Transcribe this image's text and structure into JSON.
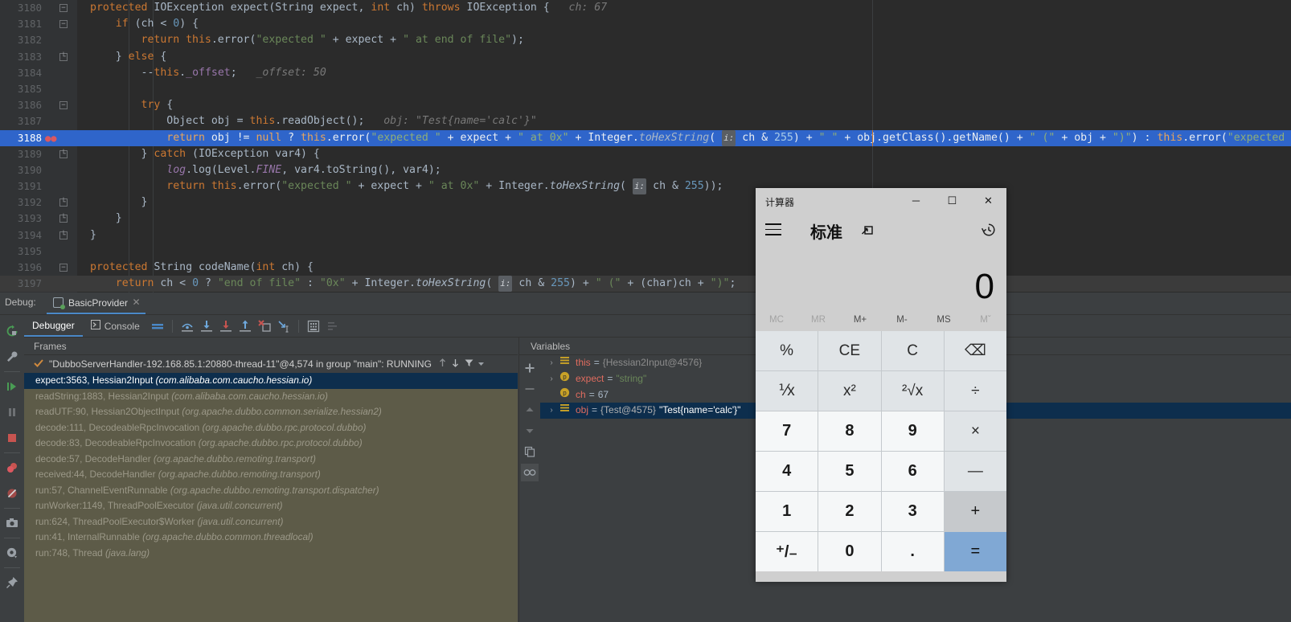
{
  "editor": {
    "lines": [
      {
        "num": "3180",
        "fold": "open",
        "bp": "",
        "hl": false,
        "tokens": [
          {
            "t": "protected ",
            "c": "kw"
          },
          {
            "t": "IOException ",
            "c": "plain"
          },
          {
            "t": "expect",
            "c": "plain"
          },
          {
            "t": "(",
            "c": "plain"
          },
          {
            "t": "String ",
            "c": "plain"
          },
          {
            "t": "expect",
            "c": "plain"
          },
          {
            "t": ", ",
            "c": "plain"
          },
          {
            "t": "int",
            "c": "kw"
          },
          {
            "t": " ch) ",
            "c": "plain"
          },
          {
            "t": "throws ",
            "c": "kw"
          },
          {
            "t": "IOException {",
            "c": "plain"
          },
          {
            "t": "   ch: 67",
            "c": "hint"
          }
        ]
      },
      {
        "num": "3181",
        "fold": "open",
        "bp": "",
        "hl": false,
        "tokens": [
          {
            "t": "    if",
            "c": "kw"
          },
          {
            "t": " (ch ",
            "c": "plain"
          },
          {
            "t": "<",
            "c": "plain"
          },
          {
            "t": " ",
            "c": "plain"
          },
          {
            "t": "0",
            "c": "num"
          },
          {
            "t": ") {",
            "c": "plain"
          }
        ]
      },
      {
        "num": "3182",
        "fold": "",
        "bp": "",
        "hl": false,
        "tokens": [
          {
            "t": "        return ",
            "c": "kw"
          },
          {
            "t": "this",
            "c": "kw"
          },
          {
            "t": ".error(",
            "c": "plain"
          },
          {
            "t": "\"expected \"",
            "c": "str"
          },
          {
            "t": " + expect + ",
            "c": "plain"
          },
          {
            "t": "\" at end of file\"",
            "c": "str"
          },
          {
            "t": ");",
            "c": "plain"
          }
        ]
      },
      {
        "num": "3183",
        "fold": "close",
        "bp": "",
        "hl": false,
        "tokens": [
          {
            "t": "    } ",
            "c": "plain"
          },
          {
            "t": "else",
            "c": "kw"
          },
          {
            "t": " {",
            "c": "plain"
          }
        ]
      },
      {
        "num": "3184",
        "fold": "",
        "bp": "",
        "hl": false,
        "tokens": [
          {
            "t": "        --",
            "c": "plain"
          },
          {
            "t": "this",
            "c": "kw"
          },
          {
            "t": ".",
            "c": "plain"
          },
          {
            "t": "_offset",
            "c": "fld"
          },
          {
            "t": ";",
            "c": "plain"
          },
          {
            "t": "   _offset: 50",
            "c": "hint"
          }
        ]
      },
      {
        "num": "3185",
        "fold": "",
        "bp": "",
        "hl": false,
        "tokens": []
      },
      {
        "num": "3186",
        "fold": "open",
        "bp": "",
        "hl": false,
        "tokens": [
          {
            "t": "        try",
            "c": "kw"
          },
          {
            "t": " {",
            "c": "plain"
          }
        ]
      },
      {
        "num": "3187",
        "fold": "",
        "bp": "",
        "hl": false,
        "tokens": [
          {
            "t": "            Object obj = ",
            "c": "plain"
          },
          {
            "t": "this",
            "c": "kw"
          },
          {
            "t": ".readObject();",
            "c": "plain"
          },
          {
            "t": "   obj: \"Test{name='calc'}\"",
            "c": "hint"
          }
        ]
      },
      {
        "num": "3188",
        "fold": "",
        "bp": "bp",
        "hl": true,
        "tokens": [
          {
            "t": "            return ",
            "c": "kw"
          },
          {
            "t": "obj != ",
            "c": "plain"
          },
          {
            "t": "null",
            "c": "kw"
          },
          {
            "t": " ? ",
            "c": "plain"
          },
          {
            "t": "this",
            "c": "kw"
          },
          {
            "t": ".error(",
            "c": "plain"
          },
          {
            "t": "\"expected \"",
            "c": "str"
          },
          {
            "t": " + expect + ",
            "c": "plain"
          },
          {
            "t": "\" at 0x\"",
            "c": "str"
          },
          {
            "t": " + Integer.",
            "c": "plain"
          },
          {
            "t": "toHexString",
            "c": "mth-it"
          },
          {
            "t": "( ",
            "c": "plain"
          },
          {
            "t": "i:",
            "c": "chip"
          },
          {
            "t": " ch & ",
            "c": "plain"
          },
          {
            "t": "255",
            "c": "num"
          },
          {
            "t": ") + ",
            "c": "plain"
          },
          {
            "t": "\" \"",
            "c": "str"
          },
          {
            "t": " + obj.getClass().getName() + ",
            "c": "plain"
          },
          {
            "t": "\" (\"",
            "c": "str"
          },
          {
            "t": " + obj + ",
            "c": "plain"
          },
          {
            "t": "\")\"",
            "c": "str"
          },
          {
            "t": ") : ",
            "c": "plain"
          },
          {
            "t": "this",
            "c": "kw"
          },
          {
            "t": ".error(",
            "c": "plain"
          },
          {
            "t": "\"expected",
            "c": "str"
          }
        ]
      },
      {
        "num": "3189",
        "fold": "close",
        "bp": "",
        "hl": false,
        "tokens": [
          {
            "t": "        } ",
            "c": "plain"
          },
          {
            "t": "catch",
            "c": "kw"
          },
          {
            "t": " (IOException var4) {",
            "c": "plain"
          }
        ]
      },
      {
        "num": "3190",
        "fold": "",
        "bp": "",
        "hl": false,
        "tokens": [
          {
            "t": "            ",
            "c": "plain"
          },
          {
            "t": "log",
            "c": "static-it"
          },
          {
            "t": ".log(Level.",
            "c": "plain"
          },
          {
            "t": "FINE",
            "c": "static-it"
          },
          {
            "t": ", var4.toString(), var4);",
            "c": "plain"
          }
        ]
      },
      {
        "num": "3191",
        "fold": "",
        "bp": "",
        "hl": false,
        "tokens": [
          {
            "t": "            return ",
            "c": "kw"
          },
          {
            "t": "this",
            "c": "kw"
          },
          {
            "t": ".error(",
            "c": "plain"
          },
          {
            "t": "\"expected \"",
            "c": "str"
          },
          {
            "t": " + expect + ",
            "c": "plain"
          },
          {
            "t": "\" at 0x\"",
            "c": "str"
          },
          {
            "t": " + Integer.",
            "c": "plain"
          },
          {
            "t": "toHexString",
            "c": "mth-it"
          },
          {
            "t": "( ",
            "c": "plain"
          },
          {
            "t": "i:",
            "c": "chip"
          },
          {
            "t": " ch & ",
            "c": "plain"
          },
          {
            "t": "255",
            "c": "num"
          },
          {
            "t": "));",
            "c": "plain"
          }
        ]
      },
      {
        "num": "3192",
        "fold": "close",
        "bp": "",
        "hl": false,
        "tokens": [
          {
            "t": "        }",
            "c": "plain"
          }
        ]
      },
      {
        "num": "3193",
        "fold": "close",
        "bp": "",
        "hl": false,
        "tokens": [
          {
            "t": "    }",
            "c": "plain"
          }
        ]
      },
      {
        "num": "3194",
        "fold": "close",
        "bp": "",
        "hl": false,
        "tokens": [
          {
            "t": "}",
            "c": "plain"
          }
        ]
      },
      {
        "num": "3195",
        "fold": "",
        "bp": "",
        "hl": false,
        "tokens": []
      },
      {
        "num": "3196",
        "fold": "open",
        "bp": "",
        "hl": false,
        "tokens": [
          {
            "t": "protected ",
            "c": "kw"
          },
          {
            "t": "String ",
            "c": "plain"
          },
          {
            "t": "codeName",
            "c": "plain"
          },
          {
            "t": "(",
            "c": "plain"
          },
          {
            "t": "int",
            "c": "kw"
          },
          {
            "t": " ch) {",
            "c": "plain"
          }
        ]
      },
      {
        "num": "3197",
        "fold": "",
        "bp": "",
        "hl": false,
        "soft": true,
        "tokens": [
          {
            "t": "    return ",
            "c": "kw"
          },
          {
            "t": "ch ",
            "c": "plain"
          },
          {
            "t": "< ",
            "c": "plain"
          },
          {
            "t": "0",
            "c": "num"
          },
          {
            "t": " ? ",
            "c": "plain"
          },
          {
            "t": "\"end of file\"",
            "c": "str"
          },
          {
            "t": " : ",
            "c": "plain"
          },
          {
            "t": "\"0x\"",
            "c": "str"
          },
          {
            "t": " + Integer.",
            "c": "plain"
          },
          {
            "t": "toHexString",
            "c": "mth-it"
          },
          {
            "t": "( ",
            "c": "plain"
          },
          {
            "t": "i:",
            "c": "chip"
          },
          {
            "t": " ch & ",
            "c": "plain"
          },
          {
            "t": "255",
            "c": "num"
          },
          {
            "t": ") + ",
            "c": "plain"
          },
          {
            "t": "\" (\"",
            "c": "str"
          },
          {
            "t": " + (char)ch + ",
            "c": "plain"
          },
          {
            "t": "\")\"",
            "c": "str"
          },
          {
            "t": ";",
            "c": "plain"
          }
        ]
      }
    ]
  },
  "debug": {
    "label": "Debug:",
    "session_tab": "BasicProvider",
    "tabs": [
      {
        "label": "Debugger",
        "active": true
      },
      {
        "label": "Console",
        "active": false
      }
    ],
    "toolbar_icons": [
      "mute-breakpoints-icon",
      "step-over-icon",
      "step-into-icon",
      "force-step-into-icon",
      "step-out-icon",
      "run-to-cursor-icon",
      "drop-frame-icon",
      "evaluate-expression-icon",
      "settings-list-icon"
    ],
    "rail_icons": [
      "rerun-icon",
      "wrench-icon",
      "resume-icon",
      "pause-icon",
      "stop-icon",
      "view-breakpoints-icon",
      "mute-breakpoints-icon",
      "camera-icon",
      "settings-gear-icon",
      "pin-icon"
    ],
    "frames": {
      "title": "Frames",
      "thread": "\"DubboServerHandler-192.168.85.1:20880-thread-11\"@4,574 in group \"main\": RUNNING",
      "tools": [
        "arrow-up-icon",
        "arrow-down-icon",
        "filter-icon",
        "chevron-down-icon"
      ],
      "items": [
        {
          "method": "expect:3563, Hessian2Input ",
          "pkg": "(com.alibaba.com.caucho.hessian.io)",
          "selected": true
        },
        {
          "method": "readString:1883, Hessian2Input ",
          "pkg": "(com.alibaba.com.caucho.hessian.io)",
          "selected": false
        },
        {
          "method": "readUTF:90, Hessian2ObjectInput ",
          "pkg": "(org.apache.dubbo.common.serialize.hessian2)",
          "selected": false
        },
        {
          "method": "decode:111, DecodeableRpcInvocation ",
          "pkg": "(org.apache.dubbo.rpc.protocol.dubbo)",
          "selected": false
        },
        {
          "method": "decode:83, DecodeableRpcInvocation ",
          "pkg": "(org.apache.dubbo.rpc.protocol.dubbo)",
          "selected": false
        },
        {
          "method": "decode:57, DecodeHandler ",
          "pkg": "(org.apache.dubbo.remoting.transport)",
          "selected": false
        },
        {
          "method": "received:44, DecodeHandler ",
          "pkg": "(org.apache.dubbo.remoting.transport)",
          "selected": false
        },
        {
          "method": "run:57, ChannelEventRunnable ",
          "pkg": "(org.apache.dubbo.remoting.transport.dispatcher)",
          "selected": false
        },
        {
          "method": "runWorker:1149, ThreadPoolExecutor ",
          "pkg": "(java.util.concurrent)",
          "selected": false
        },
        {
          "method": "run:624, ThreadPoolExecutor$Worker ",
          "pkg": "(java.util.concurrent)",
          "selected": false
        },
        {
          "method": "run:41, InternalRunnable ",
          "pkg": "(org.apache.dubbo.common.threadlocal)",
          "selected": false
        },
        {
          "method": "run:748, Thread ",
          "pkg": "(java.lang)",
          "selected": false
        }
      ]
    },
    "variables": {
      "title": "Variables",
      "rail_icons": [
        "plus-icon",
        "minus-icon",
        "arrow-up-icon",
        "arrow-down-icon",
        "copy-icon",
        "watches-icon"
      ],
      "items": [
        {
          "twisty": "›",
          "kind": "field",
          "name": "this",
          "eq": " = ",
          "ref": "{Hessian2Input@4576}",
          "value": "",
          "selected": false
        },
        {
          "twisty": "›",
          "kind": "param",
          "name": "expect",
          "eq": " = ",
          "ref": "",
          "value": "\"string\"",
          "selected": false
        },
        {
          "twisty": "",
          "kind": "param",
          "name": "ch",
          "eq": " = ",
          "ref": "",
          "value": "67",
          "selected": false
        },
        {
          "twisty": "›",
          "kind": "field",
          "name": "obj",
          "eq": " = ",
          "ref": "{Test@4575}",
          "value": "\"Test{name='calc'}\"",
          "selected": true
        }
      ]
    }
  },
  "calculator": {
    "title": "计算器",
    "window_buttons": [
      {
        "name": "minimize-button",
        "glyph": "─"
      },
      {
        "name": "maximize-button",
        "glyph": "☐"
      },
      {
        "name": "close-button",
        "glyph": "✕"
      }
    ],
    "menu_icon": "hamburger-menu-icon",
    "mode": "标准",
    "keep_on_top_icon": "keep-on-top-icon",
    "history_icon": "history-icon",
    "display_value": "0",
    "memory": [
      {
        "label": "MC",
        "dim": true
      },
      {
        "label": "MR",
        "dim": true
      },
      {
        "label": "M+",
        "dim": false
      },
      {
        "label": "M-",
        "dim": false
      },
      {
        "label": "MS",
        "dim": false
      },
      {
        "label": "Mˇ",
        "dim": true
      }
    ],
    "keys": [
      {
        "label": "%",
        "style": "op",
        "name": "key-percent"
      },
      {
        "label": "CE",
        "style": "op",
        "name": "key-clear-entry"
      },
      {
        "label": "C",
        "style": "op",
        "name": "key-clear"
      },
      {
        "label": "⌫",
        "style": "op",
        "name": "key-backspace"
      },
      {
        "label": "⅟x",
        "style": "op",
        "name": "key-reciprocal"
      },
      {
        "label": "x²",
        "style": "op",
        "name": "key-square"
      },
      {
        "label": "²√x",
        "style": "op",
        "name": "key-square-root"
      },
      {
        "label": "÷",
        "style": "op",
        "name": "key-divide"
      },
      {
        "label": "7",
        "style": "num",
        "name": "key-7"
      },
      {
        "label": "8",
        "style": "num",
        "name": "key-8"
      },
      {
        "label": "9",
        "style": "num",
        "name": "key-9"
      },
      {
        "label": "×",
        "style": "op",
        "name": "key-multiply"
      },
      {
        "label": "4",
        "style": "num",
        "name": "key-4"
      },
      {
        "label": "5",
        "style": "num",
        "name": "key-5"
      },
      {
        "label": "6",
        "style": "num",
        "name": "key-6"
      },
      {
        "label": "—",
        "style": "op",
        "name": "key-subtract"
      },
      {
        "label": "1",
        "style": "num",
        "name": "key-1"
      },
      {
        "label": "2",
        "style": "num",
        "name": "key-2"
      },
      {
        "label": "3",
        "style": "num",
        "name": "key-3"
      },
      {
        "label": "+",
        "style": "plus",
        "name": "key-add"
      },
      {
        "label": "⁺/₋",
        "style": "num",
        "name": "key-sign"
      },
      {
        "label": "0",
        "style": "num",
        "name": "key-0"
      },
      {
        "label": ".",
        "style": "num",
        "name": "key-decimal"
      },
      {
        "label": "=",
        "style": "eq",
        "name": "key-equals"
      }
    ]
  }
}
